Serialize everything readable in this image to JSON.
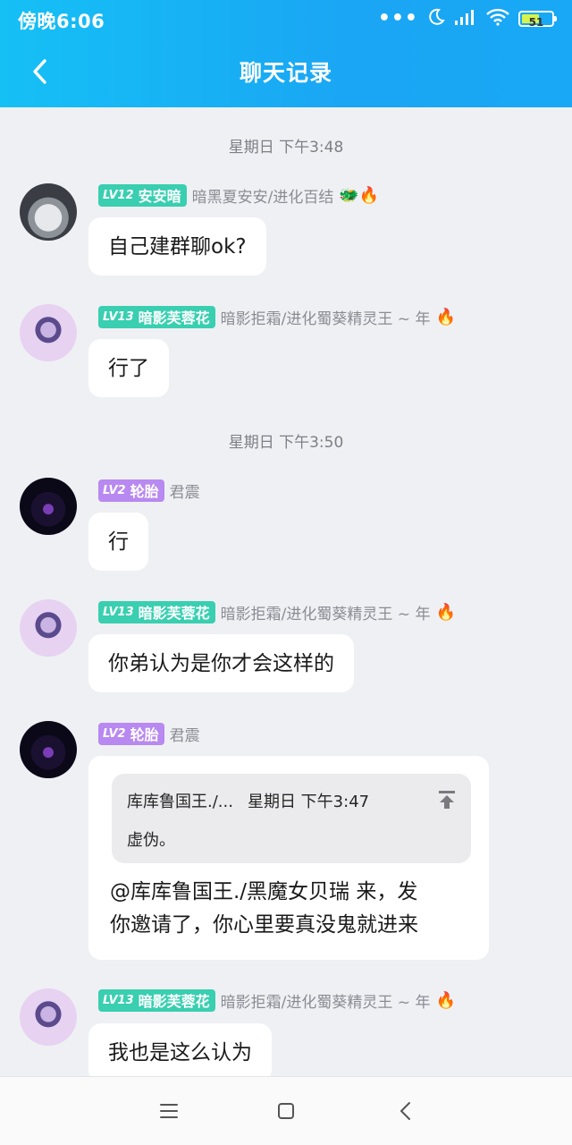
{
  "status_bar": {
    "time": "傍晚6:06",
    "battery": "51"
  },
  "header": {
    "title": "聊天记录"
  },
  "time_separators": [
    "星期日 下午3:48",
    "星期日 下午3:50"
  ],
  "messages": [
    {
      "level": "LV12",
      "name": "安安暗",
      "title": "暗黑夏安安/进化百结",
      "emoji": "🐲🔥",
      "text": "自己建群聊ok?"
    },
    {
      "level": "LV13",
      "name": "暗影芙蓉花",
      "title": "暗影拒霜/进化蜀葵精灵王 ~ 年",
      "emoji": "🔥",
      "text": "行了"
    },
    {
      "level": "LV2",
      "name": "轮胎",
      "title": "君震",
      "text": "行"
    },
    {
      "level": "LV13",
      "name": "暗影芙蓉花",
      "title": "暗影拒霜/进化蜀葵精灵王 ~ 年",
      "emoji": "🔥",
      "text": "你弟认为是你才会这样的"
    },
    {
      "level": "LV2",
      "name": "轮胎",
      "title": "君震",
      "quote": {
        "sender": "库库鲁国王./...",
        "time": "星期日 下午3:47",
        "text": "虚伪。"
      },
      "text_line1": "@库库鲁国王./黑魔女贝瑞 来，发",
      "text_line2": "你邀请了，你心里要真没鬼就进来"
    },
    {
      "level": "LV13",
      "name": "暗影芙蓉花",
      "title": "暗影拒霜/进化蜀葵精灵王 ~ 年",
      "emoji": "🔥",
      "text": "我也是这么认为"
    }
  ]
}
